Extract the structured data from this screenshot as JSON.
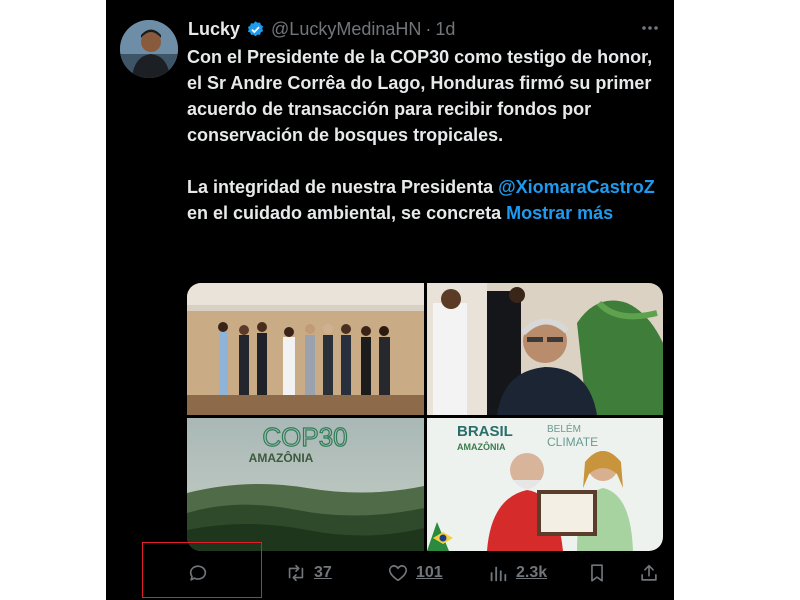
{
  "tweet": {
    "author_name": "Lucky",
    "handle": "@LuckyMedinaHN",
    "separator": "·",
    "time": "1d",
    "paragraph1": "Con el Presidente de la COP30 como testigo de honor, el Sr Andre Corrêa do Lago, Honduras firmó su primer acuerdo de transacción para recibir fondos por conservación de bosques tropicales.",
    "paragraph2_before": "La integridad de nuestra Presidenta ",
    "mention": "@XiomaraCastroZ",
    "paragraph2_after": " en el cuidado ambiental, se concreta ",
    "show_more": "Mostrar más"
  },
  "media": {
    "tile3": {
      "line1": "COP30",
      "line2": "AMAZÔNIA"
    },
    "tile4": {
      "line1": "BRASIL",
      "line2": "AMAZÔNIA",
      "line3": "BELÉM",
      "line4": "CLIMATE"
    }
  },
  "actions": {
    "reply_icon": "reply-icon",
    "retweet_count": "37",
    "like_count": "101",
    "views_count": "2.3k",
    "bookmark_icon": "bookmark-icon",
    "share_icon": "share-icon"
  },
  "colors": {
    "background": "#000000",
    "text": "#e7e9ea",
    "muted": "#71767b",
    "link": "#1d9bf0",
    "highlight_box": "#e11d2a"
  }
}
